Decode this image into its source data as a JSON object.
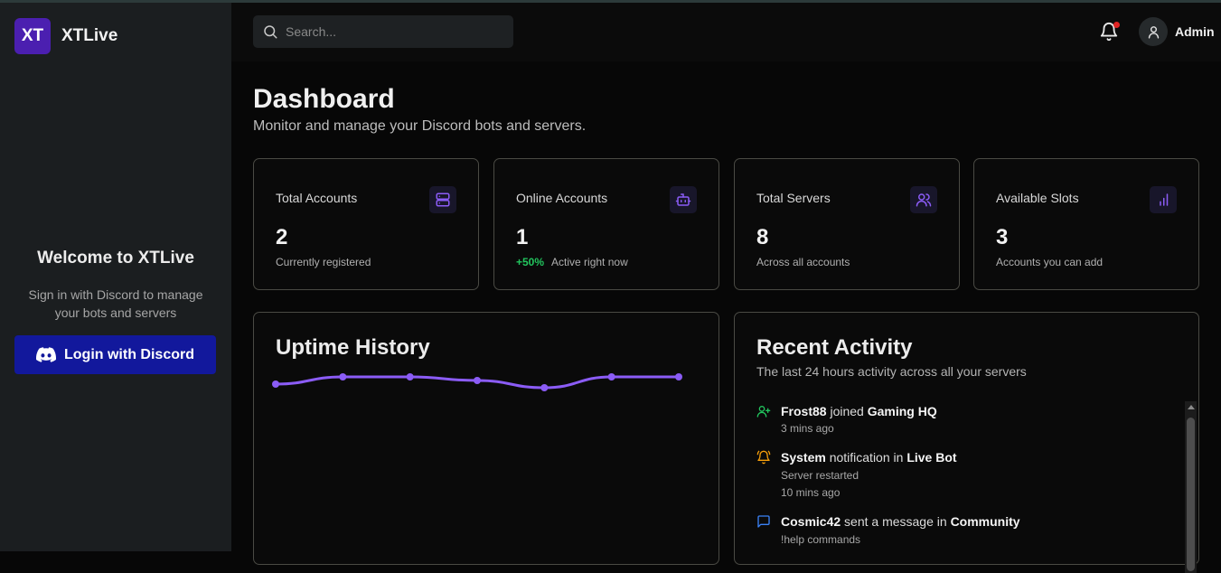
{
  "brand": {
    "logo": "XT",
    "name": "XTLive"
  },
  "sidebar": {
    "welcome_title": "Welcome to XTLive",
    "welcome_subtitle": "Sign in with Discord to manage your bots and servers",
    "login_label": "Login with Discord"
  },
  "header": {
    "search_placeholder": "Search...",
    "user_name": "Admin",
    "has_notification": true
  },
  "page": {
    "title": "Dashboard",
    "subtitle": "Monitor and manage your Discord bots and servers."
  },
  "stats": [
    {
      "label": "Total Accounts",
      "value": "2",
      "change": "",
      "note": "Currently registered",
      "icon": "server-icon"
    },
    {
      "label": "Online Accounts",
      "value": "1",
      "change": "+50%",
      "note": "Active right now",
      "icon": "bot-icon"
    },
    {
      "label": "Total Servers",
      "value": "8",
      "change": "",
      "note": "Across all accounts",
      "icon": "users-icon"
    },
    {
      "label": "Available Slots",
      "value": "3",
      "change": "",
      "note": "Accounts you can add",
      "icon": "bar-chart-icon"
    }
  ],
  "uptime": {
    "title": "Uptime History"
  },
  "chart_data": {
    "type": "line",
    "title": "Uptime History",
    "values": [
      98,
      99,
      99,
      98.5,
      97.5,
      99,
      99
    ],
    "ylim": [
      90,
      100
    ],
    "color": "#8b5cf6"
  },
  "activity": {
    "title": "Recent Activity",
    "subtitle": "The last 24 hours activity across all your servers",
    "items": [
      {
        "icon": "user-plus-icon",
        "actor": "Frost88",
        "action": " joined ",
        "target": "Gaming HQ",
        "detail": "",
        "time": "3 mins ago"
      },
      {
        "icon": "bell-ring-icon",
        "actor": "System",
        "action": " notification in ",
        "target": "Live Bot",
        "detail": "Server restarted",
        "time": "10 mins ago"
      },
      {
        "icon": "message-icon",
        "actor": "Cosmic42",
        "action": " sent a message in ",
        "target": "Community",
        "detail": "!help commands",
        "time": ""
      }
    ]
  },
  "colors": {
    "accent": "#8b5cf6",
    "brand": "#4b1fb0",
    "login": "#12189c",
    "positive": "#22c55e",
    "notify": "#e02424"
  }
}
